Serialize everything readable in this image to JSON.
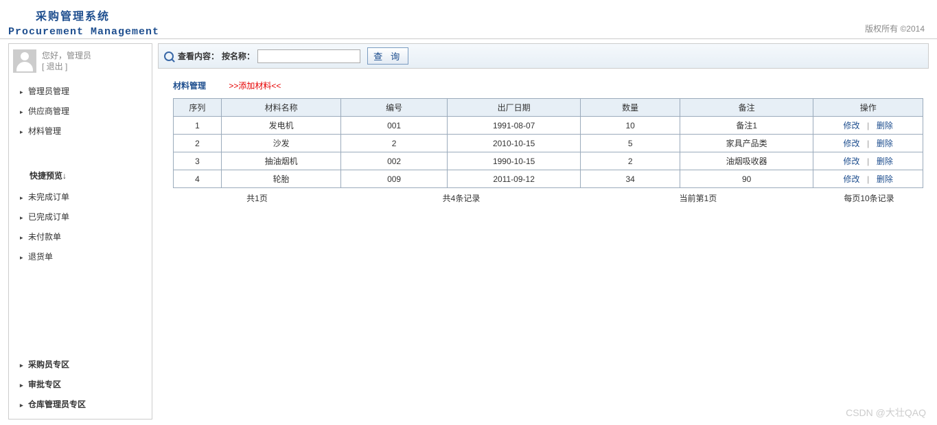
{
  "header": {
    "title_cn": "采购管理系统",
    "title_en": "Procurement Management",
    "copyright": "版权所有   ©2014"
  },
  "user": {
    "greeting": "您好，",
    "role": "管理员",
    "logout": "[ 退出 ]"
  },
  "sidebar": {
    "group1": [
      "管理员管理",
      "供应商管理",
      "材料管理"
    ],
    "quick_heading": "快捷预览↓",
    "group2": [
      "未完成订单",
      "已完成订单",
      "未付款单",
      "退货单"
    ],
    "group3": [
      "采购员专区",
      "审批专区",
      "仓库管理员专区"
    ]
  },
  "search": {
    "label": "查看内容：",
    "mode": "按名称：",
    "value": "",
    "btn": "查 询"
  },
  "crumb": {
    "cat": "材料管理",
    "add": ">>添加材料<<"
  },
  "table": {
    "headers": [
      "序列",
      "材料名称",
      "编号",
      "出厂日期",
      "数量",
      "备注",
      "操作"
    ],
    "rows": [
      {
        "seq": "1",
        "name": "发电机",
        "code": "001",
        "date": "1991-08-07",
        "qty": "10",
        "note": "备注1"
      },
      {
        "seq": "2",
        "name": "沙发",
        "code": "2",
        "date": "2010-10-15",
        "qty": "5",
        "note": "家具产品类"
      },
      {
        "seq": "3",
        "name": "抽油烟机",
        "code": "002",
        "date": "1990-10-15",
        "qty": "2",
        "note": "油烟吸收器"
      },
      {
        "seq": "4",
        "name": "轮胎",
        "code": "009",
        "date": "2011-09-12",
        "qty": "34",
        "note": "90"
      }
    ],
    "ops": {
      "edit": "修改",
      "del": "删除"
    }
  },
  "summary": {
    "pages": "共1页",
    "records": "共4条记录",
    "current": "当前第1页",
    "perpage": "每页10条记录"
  },
  "watermark": "CSDN @大壮QAQ"
}
